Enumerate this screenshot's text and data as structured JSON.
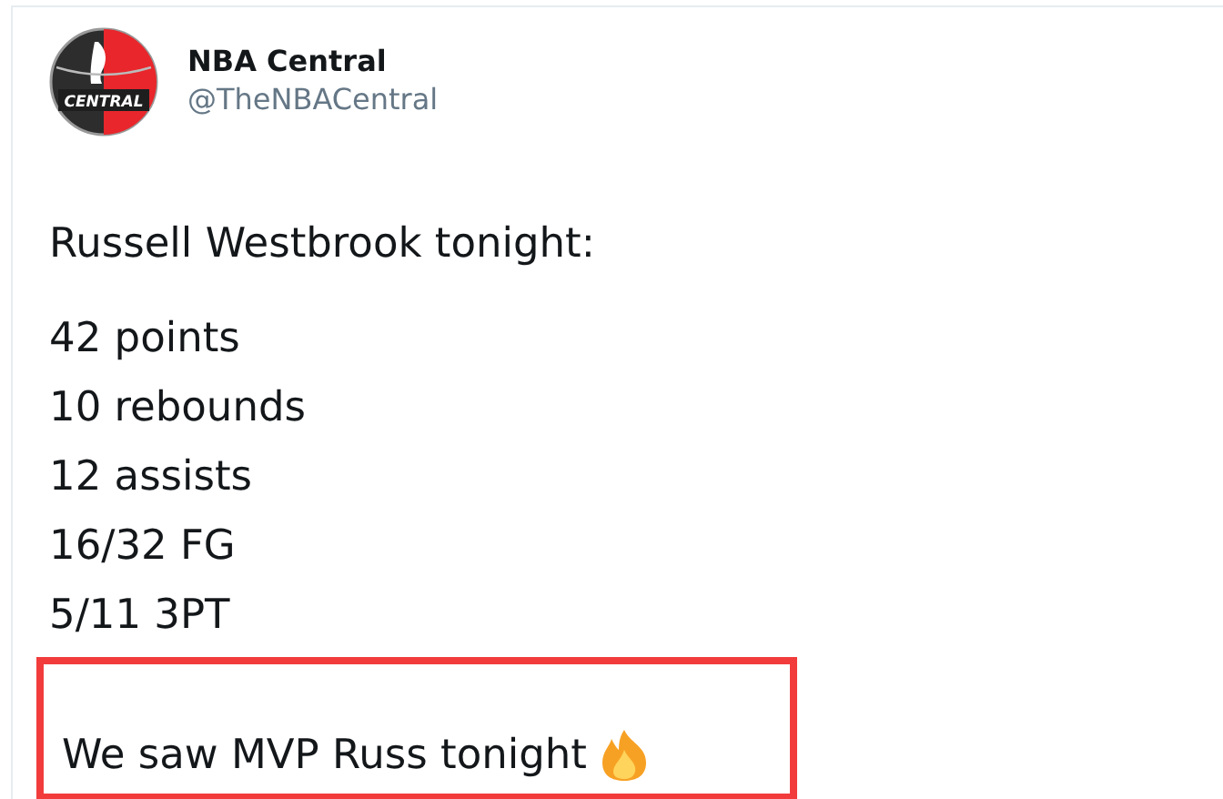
{
  "author": {
    "name": "NBA Central",
    "handle": "@TheNBACentral",
    "avatar_label": "CENTRAL"
  },
  "tweet": {
    "intro": "Russell Westbrook tonight:",
    "stats": [
      "42 points",
      "10 rebounds",
      "12 assists",
      "16/32 FG",
      "5/11 3PT"
    ],
    "closing": {
      "text": "We saw MVP Russ tonight",
      "highlighted": true
    }
  }
}
